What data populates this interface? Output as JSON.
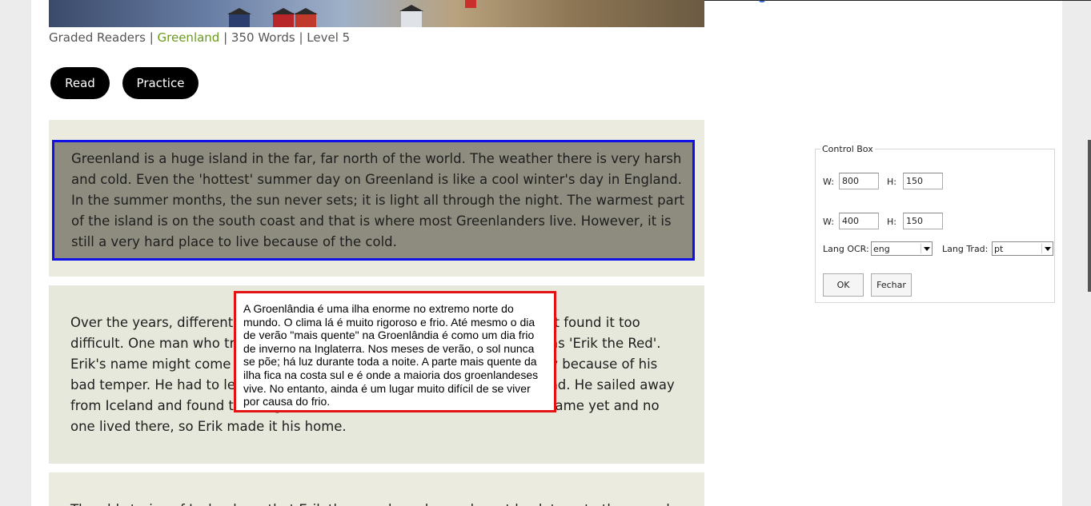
{
  "meta": {
    "prefix": "Graded Readers | ",
    "link": "Greenland",
    "suffix": " | 350 Words | Level 5"
  },
  "buttons": {
    "read": "Read",
    "practice": "Practice"
  },
  "paragraphs": [
    "Greenland is a huge island in the far, far north of the world. The weather there is very harsh and cold. Even the 'hottest' summer day on Greenland is like a cool winter's day in England. In the summer months, the sun never sets; it is light all through the night. The warmest part of the island is on the south coast and that is where most Greenlanders live. However, it is still a very hard place to live because of the cold.",
    "Over the years, different people have tried to live on Greenland, but most found it too difficult. One man who tried, and who is famous among Greenlanders, was 'Erik the Red'. Erik's name might come from the colour of his hair and beard, or possibly because of his bad temper. He had to leave his home in Norway, then his home in Iceland. He sailed away from Iceland and found this huge ice-covered island. This island had no name yet and no one lived there, so Erik made it his home.",
    "The old stories of Iceland say that Erik then made a plan and went back to get other people."
  ],
  "translation_popup": "A Groenlândia é uma ilha enorme no extremo norte do mundo. O clima lá é muito rigoroso e frio. Até mesmo o dia de verão \"mais quente\" na Groenlândia é como um dia frio de inverno na Inglaterra. Nos meses de verão, o sol nunca se põe; há luz durante toda a noite. A parte mais quente da ilha fica na costa sul e é onde a maioria dos groenlandeses vive. No entanto, ainda é um lugar muito difícil de se viver por causa do frio.",
  "control_box": {
    "title": "Control Box",
    "w_label": "W:",
    "h_label": "H:",
    "w1": "800",
    "h1": "150",
    "w2": "400",
    "h2": "150",
    "lang_ocr_label": "Lang OCR:",
    "lang_ocr_value": "eng",
    "lang_trad_label": "Lang Trad:",
    "lang_trad_value": "pt",
    "ok_label": "OK",
    "close_label": "Fechar"
  },
  "colors": {
    "selection_border": "#1010e8",
    "popup_border": "#e31313",
    "link_green": "#6a9a1f",
    "button_bg": "#000000"
  }
}
